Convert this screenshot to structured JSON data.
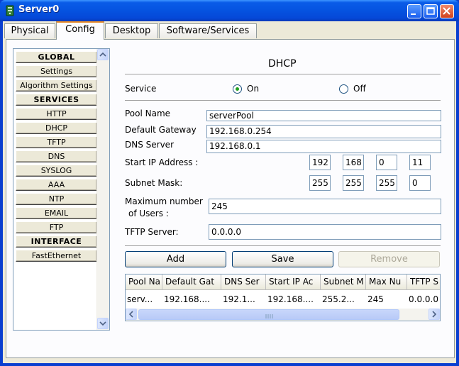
{
  "window": {
    "title": "Server0"
  },
  "tabs": [
    {
      "label": "Physical"
    },
    {
      "label": "Config"
    },
    {
      "label": "Desktop"
    },
    {
      "label": "Software/Services"
    }
  ],
  "active_tab": "Config",
  "sidebar": {
    "items": [
      {
        "label": "GLOBAL",
        "header": true
      },
      {
        "label": "Settings"
      },
      {
        "label": "Algorithm Settings"
      },
      {
        "label": "SERVICES",
        "header": true
      },
      {
        "label": "HTTP"
      },
      {
        "label": "DHCP"
      },
      {
        "label": "TFTP"
      },
      {
        "label": "DNS"
      },
      {
        "label": "SYSLOG"
      },
      {
        "label": "AAA"
      },
      {
        "label": "NTP"
      },
      {
        "label": "EMAIL"
      },
      {
        "label": "FTP"
      },
      {
        "label": "INTERFACE",
        "header": true
      },
      {
        "label": "FastEthernet"
      }
    ]
  },
  "dhcp": {
    "heading": "DHCP",
    "service_label": "Service",
    "on_label": "On",
    "off_label": "Off",
    "service_state": "On",
    "pool_name_label": "Pool Name",
    "pool_name": "serverPool",
    "gateway_label": "Default Gateway",
    "gateway": "192.168.0.254",
    "dns_label": "DNS Server",
    "dns": "192.168.0.1",
    "start_ip_label": "Start IP Address :",
    "start_ip": [
      "192",
      "168",
      "0",
      "11"
    ],
    "subnet_label": "Subnet Mask:",
    "subnet": [
      "255",
      "255",
      "255",
      "0"
    ],
    "max_users_label_1": "Maximum number",
    "max_users_label_2": "of Users :",
    "max_users": "245",
    "tftp_label": "TFTP Server:",
    "tftp": "0.0.0.0",
    "add_label": "Add",
    "save_label": "Save",
    "remove_label": "Remove"
  },
  "pool_table": {
    "columns": [
      "Pool Na",
      "Default Gat",
      "DNS Ser",
      "Start IP Ac",
      "Subnet M",
      "Max Nu",
      "TFTP S"
    ],
    "rows": [
      [
        "serv...",
        "192.168....",
        "192.1...",
        "192.168....",
        "255.2...",
        "245",
        "0.0.0.0"
      ]
    ]
  },
  "colors": {
    "titlebar": "#0553e0",
    "client": "#ece9d8",
    "radio_dot": "#21a121",
    "active_tab_accent": "#e68b2c"
  }
}
